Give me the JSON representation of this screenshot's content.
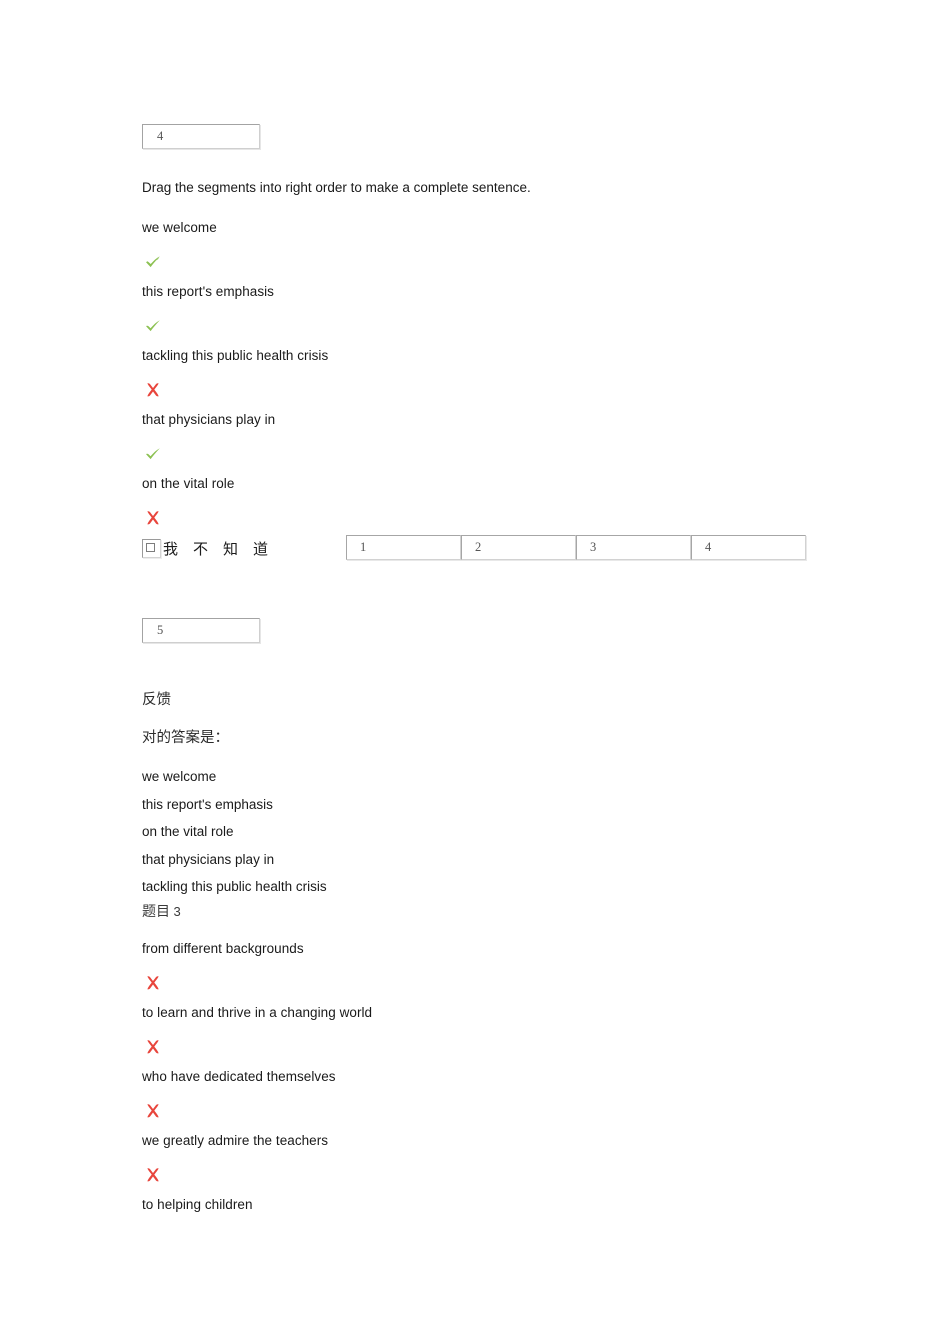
{
  "colors": {
    "correct": "#8CC152",
    "incorrect": "#E8453C",
    "text": "#1a1a1a",
    "muted": "#555555",
    "border": "#a3a3a3",
    "background": "#ffffff"
  },
  "question_four": {
    "number_field_value": "4",
    "prompt": "Drag the segments into right order to make a complete sentence.",
    "segments": [
      {
        "text": "we welcome",
        "marker": "check-icon",
        "marker_state": "correct"
      },
      {
        "text": "this report's emphasis",
        "marker": "check-icon",
        "marker_state": "correct"
      },
      {
        "text": "tackling this public health crisis",
        "marker": "cross-icon",
        "marker_state": "incorrect"
      },
      {
        "text": "that physicians play in",
        "marker": "check-icon",
        "marker_state": "correct"
      },
      {
        "text": "on the vital role",
        "marker": "cross-icon",
        "marker_state": "incorrect"
      }
    ],
    "unknown_checkbox": {
      "label": "我不知道",
      "checked": false
    },
    "dropzones": [
      "1",
      "2",
      "3",
      "4"
    ]
  },
  "question_five": {
    "number_field_value": "5"
  },
  "feedback": {
    "heading": "反馈",
    "correct_answer_label": "对的答案是：",
    "correct_answer_lines": [
      "we welcome",
      "this report's emphasis",
      "on the vital role",
      "that physicians play in",
      "tackling this public health crisis"
    ]
  },
  "question_three": {
    "heading_prefix": "题目",
    "heading_number": "3",
    "segments": [
      {
        "text": "from different backgrounds",
        "marker": "cross-icon",
        "marker_state": "incorrect"
      },
      {
        "text": "to learn and thrive in a changing world",
        "marker": "cross-icon",
        "marker_state": "incorrect"
      },
      {
        "text": "who have dedicated themselves",
        "marker": "cross-icon",
        "marker_state": "incorrect"
      },
      {
        "text": "we greatly admire the teachers",
        "marker": "cross-icon",
        "marker_state": "incorrect"
      },
      {
        "text": "to helping children",
        "marker": "cross-icon",
        "marker_state": "incorrect"
      }
    ]
  }
}
